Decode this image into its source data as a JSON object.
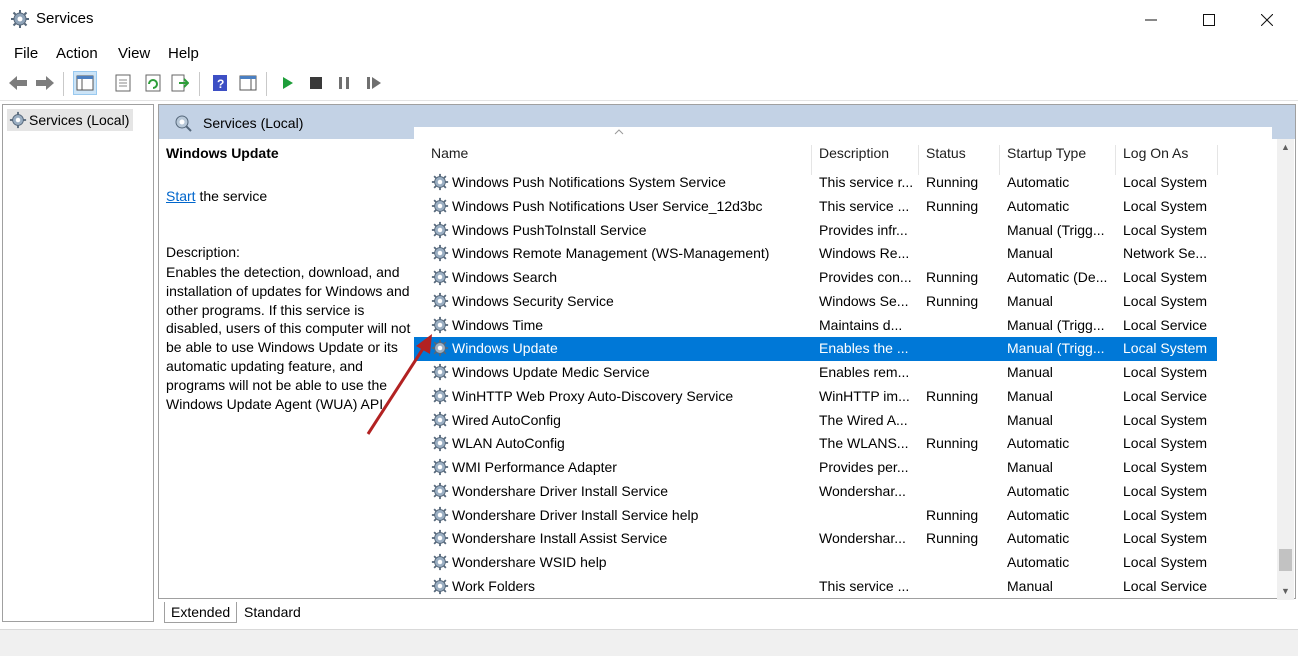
{
  "window": {
    "title": "Services",
    "minimize_icon": "minimize-icon",
    "maximize_icon": "maximize-icon",
    "close_icon": "close-icon"
  },
  "menu": {
    "items": [
      "File",
      "Action",
      "View",
      "Help"
    ]
  },
  "toolbar": {
    "icons": [
      "back-arrow-icon",
      "forward-arrow-icon",
      "show-hide-console-tree-icon",
      "properties-icon",
      "refresh-icon",
      "export-list-icon",
      "help-icon",
      "show-hide-action-pane-icon",
      "start-service-icon",
      "stop-service-icon",
      "pause-service-icon",
      "restart-service-icon"
    ]
  },
  "tree": {
    "root_label": "Services (Local)"
  },
  "main": {
    "header": "Services (Local)",
    "detail": {
      "service_name": "Windows Update",
      "start_link": "Start",
      "start_suffix": " the service",
      "description_label": "Description:",
      "description_text": "Enables the detection, download, and installation of updates for Windows and other programs. If this service is disabled, users of this computer will not be able to use Windows Update or its automatic updating feature, and programs will not be able to use the Windows Update Agent (WUA) API."
    },
    "columns": [
      "Name",
      "Description",
      "Status",
      "Startup Type",
      "Log On As"
    ],
    "rows": [
      {
        "name": "Windows Push Notifications System Service",
        "description": "This service r...",
        "status": "Running",
        "startup": "Automatic",
        "logon": "Local System"
      },
      {
        "name": "Windows Push Notifications User Service_12d3bc",
        "description": "This service ...",
        "status": "Running",
        "startup": "Automatic",
        "logon": "Local System"
      },
      {
        "name": "Windows PushToInstall Service",
        "description": "Provides infr...",
        "status": "",
        "startup": "Manual (Trigg...",
        "logon": "Local System"
      },
      {
        "name": "Windows Remote Management (WS-Management)",
        "description": "Windows Re...",
        "status": "",
        "startup": "Manual",
        "logon": "Network Se..."
      },
      {
        "name": "Windows Search",
        "description": "Provides con...",
        "status": "Running",
        "startup": "Automatic (De...",
        "logon": "Local System"
      },
      {
        "name": "Windows Security Service",
        "description": "Windows Se...",
        "status": "Running",
        "startup": "Manual",
        "logon": "Local System"
      },
      {
        "name": "Windows Time",
        "description": "Maintains d...",
        "status": "",
        "startup": "Manual (Trigg...",
        "logon": "Local Service"
      },
      {
        "name": "Windows Update",
        "description": "Enables the ...",
        "status": "",
        "startup": "Manual (Trigg...",
        "logon": "Local System"
      },
      {
        "name": "Windows Update Medic Service",
        "description": "Enables rem...",
        "status": "",
        "startup": "Manual",
        "logon": "Local System"
      },
      {
        "name": "WinHTTP Web Proxy Auto-Discovery Service",
        "description": "WinHTTP im...",
        "status": "Running",
        "startup": "Manual",
        "logon": "Local Service"
      },
      {
        "name": "Wired AutoConfig",
        "description": "The Wired A...",
        "status": "",
        "startup": "Manual",
        "logon": "Local System"
      },
      {
        "name": "WLAN AutoConfig",
        "description": "The WLANS...",
        "status": "Running",
        "startup": "Automatic",
        "logon": "Local System"
      },
      {
        "name": "WMI Performance Adapter",
        "description": "Provides per...",
        "status": "",
        "startup": "Manual",
        "logon": "Local System"
      },
      {
        "name": "Wondershare Driver Install Service",
        "description": "Wondershar...",
        "status": "",
        "startup": "Automatic",
        "logon": "Local System"
      },
      {
        "name": "Wondershare Driver Install Service help",
        "description": "",
        "status": "Running",
        "startup": "Automatic",
        "logon": "Local System"
      },
      {
        "name": "Wondershare Install Assist Service",
        "description": "Wondershar...",
        "status": "Running",
        "startup": "Automatic",
        "logon": "Local System"
      },
      {
        "name": "Wondershare WSID help",
        "description": "",
        "status": "",
        "startup": "Automatic",
        "logon": "Local System"
      },
      {
        "name": "Work Folders",
        "description": "This service ...",
        "status": "",
        "startup": "Manual",
        "logon": "Local Service"
      }
    ],
    "selected_row": 7
  },
  "tabs": {
    "extended": "Extended",
    "standard": "Standard"
  },
  "colors": {
    "selection": "#0078d7",
    "header_band": "#c3d2e5",
    "link": "#0066cc",
    "arrow": "#b22222"
  }
}
